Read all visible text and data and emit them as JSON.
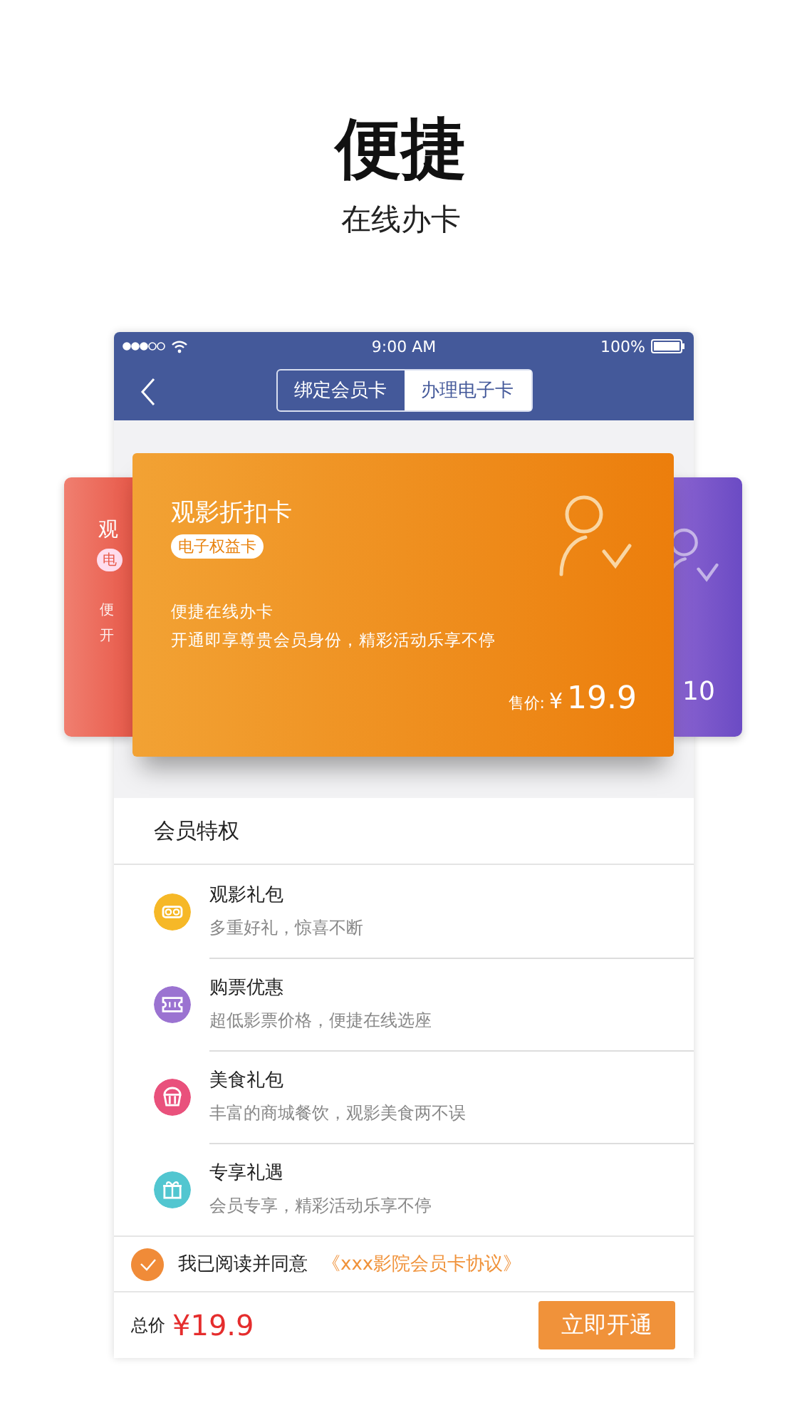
{
  "headline": {
    "title": "便捷",
    "subtitle": "在线办卡"
  },
  "status_bar": {
    "time": "9:00 AM",
    "battery": "100%"
  },
  "tabs": [
    {
      "label": "绑定会员卡",
      "selected": false
    },
    {
      "label": "办理电子卡",
      "selected": true
    }
  ],
  "cards": {
    "left_card": {
      "title": "观",
      "badge": "电",
      "lines": [
        "便",
        "开"
      ]
    },
    "main_card": {
      "title": "观影折扣卡",
      "badge": "电子权益卡",
      "lines": [
        "便捷在线办卡",
        "开通即享尊贵会员身份，精彩活动乐享不停"
      ],
      "price_label": "售价:",
      "currency": "¥",
      "price": "19.9"
    },
    "right_card": {
      "price": "10"
    }
  },
  "privileges": {
    "title": "会员特权",
    "items": [
      {
        "title": "观影礼包",
        "desc": "多重好礼，惊喜不断",
        "color": "#f6b827"
      },
      {
        "title": "购票优惠",
        "desc": "超低影票价格，便捷在线选座",
        "color": "#9b73d1"
      },
      {
        "title": "美食礼包",
        "desc": "丰富的商城餐饮，观影美食两不误",
        "color": "#e9517c"
      },
      {
        "title": "专享礼遇",
        "desc": "会员专享，精彩活动乐享不停",
        "color": "#52c6d0"
      }
    ]
  },
  "agreement": {
    "checked": true,
    "text": "我已阅读并同意",
    "link": "《xxx影院会员卡协议》"
  },
  "footer": {
    "total_label": "总价",
    "total": "¥19.9",
    "button": "立即开通"
  }
}
